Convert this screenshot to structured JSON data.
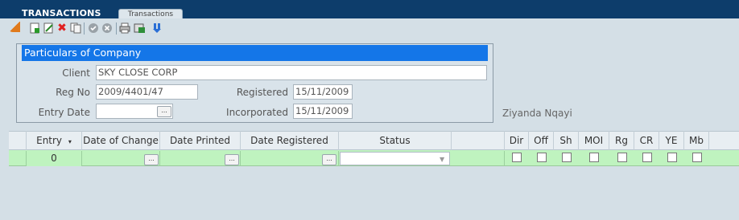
{
  "header": {
    "app_title": "TRANSACTIONS",
    "tab_label": "Transactions"
  },
  "toolbar": {
    "icons": [
      "new-icon",
      "edit-icon",
      "delete-icon",
      "copy-icon",
      "accept-icon",
      "cancel-icon",
      "print-icon",
      "export-icon",
      "download-icon"
    ]
  },
  "panel": {
    "title": "Particulars of Company",
    "client_label": "Client",
    "client_value": "SKY CLOSE CORP",
    "regno_label": "Reg No",
    "regno_value": "2009/4401/47",
    "entry_date_label": "Entry Date",
    "entry_date_value": "",
    "registered_label": "Registered",
    "registered_value": "15/11/2009",
    "incorporated_label": "Incorporated",
    "incorporated_value": "15/11/2009",
    "dots": "..."
  },
  "user": {
    "name": "Ziyanda Nqayi"
  },
  "grid": {
    "columns": [
      "Entry",
      "Date of Change",
      "Date Printed",
      "Date Registered",
      "Status",
      "Dir",
      "Off",
      "Sh",
      "MOI",
      "Rg",
      "CR",
      "YE",
      "Mb"
    ],
    "sort_indicator": "▾",
    "row": {
      "entry": "0",
      "status": ""
    }
  },
  "colors": {
    "header_bg": "#0d3d6b",
    "panel_title_bg": "#1476e8",
    "row_bg": "#bff3bf"
  }
}
